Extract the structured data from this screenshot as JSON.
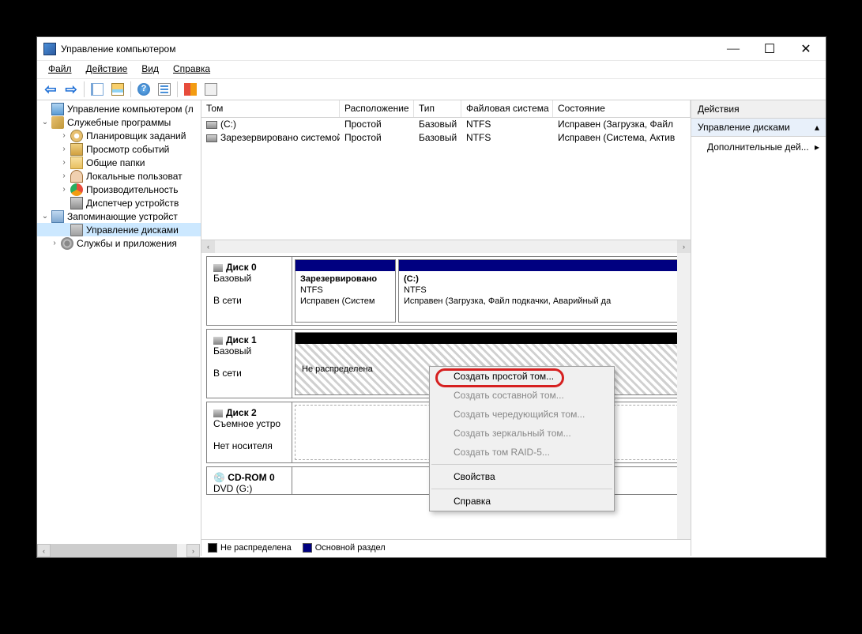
{
  "window": {
    "title": "Управление компьютером"
  },
  "menu": {
    "file": "Файл",
    "action": "Действие",
    "view": "Вид",
    "help": "Справка"
  },
  "tree": {
    "root": "Управление компьютером (л",
    "g1": "Служебные программы",
    "g1_1": "Планировщик заданий",
    "g1_2": "Просмотр событий",
    "g1_3": "Общие папки",
    "g1_4": "Локальные пользоват",
    "g1_5": "Производительность",
    "g1_6": "Диспетчер устройств",
    "g2": "Запоминающие устройст",
    "g2_1": "Управление дисками",
    "g3": "Службы и приложения"
  },
  "vol_head": {
    "tom": "Том",
    "ras": "Расположение",
    "tip": "Тип",
    "fs": "Файловая система",
    "sos": "Состояние"
  },
  "volumes": [
    {
      "tom": "(C:)",
      "ras": "Простой",
      "tip": "Базовый",
      "fs": "NTFS",
      "sos": "Исправен (Загрузка, Файл"
    },
    {
      "tom": "Зарезервировано системой",
      "ras": "Простой",
      "tip": "Базовый",
      "fs": "NTFS",
      "sos": "Исправен (Система, Актив"
    }
  ],
  "disks": {
    "d0": {
      "name": "Диск 0",
      "type": "Базовый",
      "status": "В сети"
    },
    "d0_p0": {
      "title": "Зарезервировано",
      "fs": "NTFS",
      "stat": "Исправен (Систем"
    },
    "d0_p1": {
      "title": "(C:)",
      "fs": "NTFS",
      "stat": "Исправен (Загрузка, Файл подкачки, Аварийный да"
    },
    "d1": {
      "name": "Диск 1",
      "type": "Базовый",
      "status": "В сети"
    },
    "d1_p0": {
      "label": "Не распределена"
    },
    "d2": {
      "name": "Диск 2",
      "type": "Съемное устро",
      "status": "Нет носителя"
    },
    "cd": {
      "name": "CD-ROM 0",
      "sub": "DVD (G:)"
    }
  },
  "legend": {
    "unalloc": "Не распределена",
    "primary": "Основной раздел"
  },
  "ctx": {
    "simple": "Создать простой том...",
    "spanned": "Создать составной том...",
    "striped": "Создать чередующийся том...",
    "mirror": "Создать зеркальный том...",
    "raid5": "Создать том RAID-5...",
    "props": "Свойства",
    "help": "Справка"
  },
  "actions": {
    "head": "Действия",
    "sub": "Управление дисками",
    "more": "Дополнительные дей..."
  }
}
